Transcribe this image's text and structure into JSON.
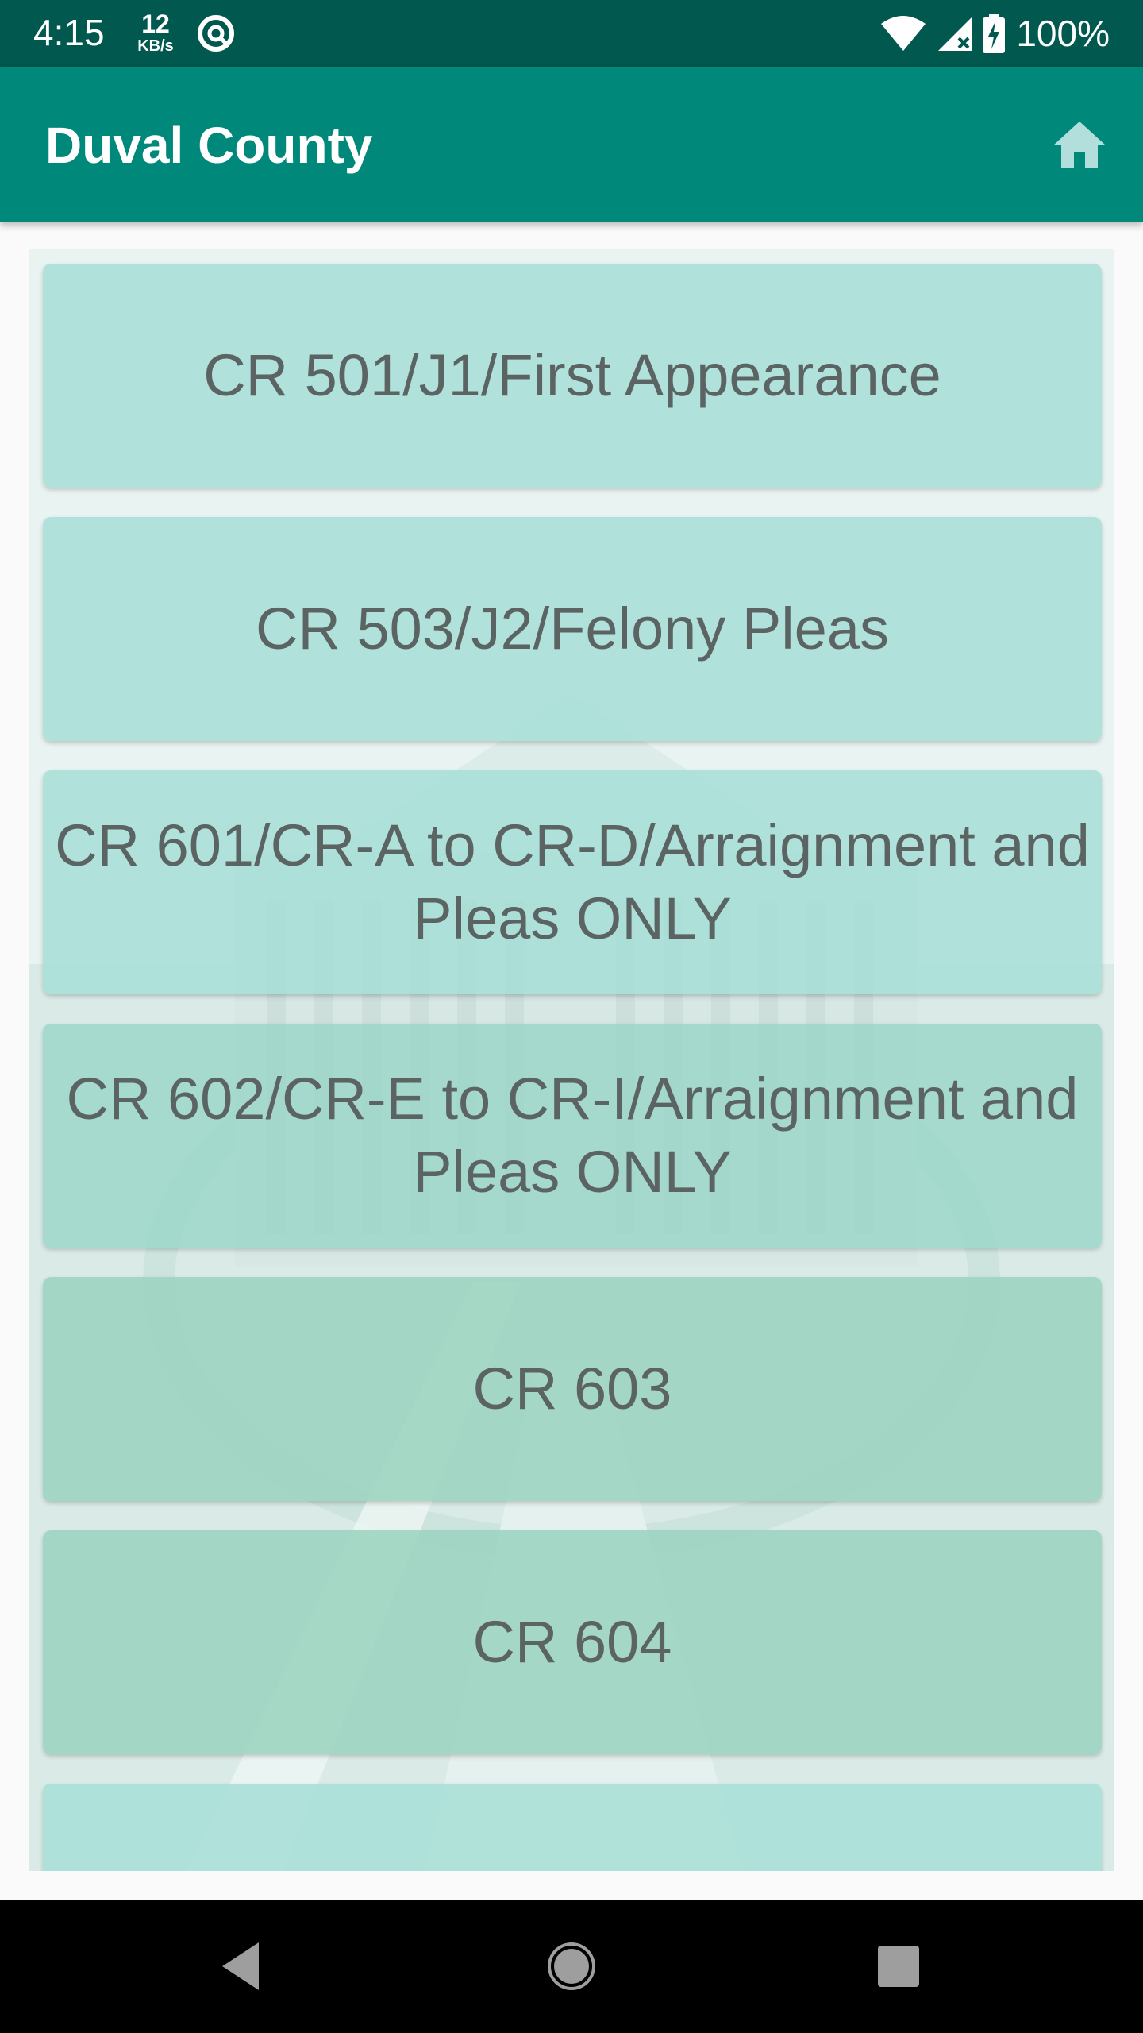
{
  "status_bar": {
    "time": "4:15",
    "network_speed_value": "12",
    "network_speed_unit": "KB/s",
    "battery_percent": "100%"
  },
  "app_bar": {
    "title": "Duval County",
    "home_icon": "home-icon"
  },
  "list": {
    "items": [
      {
        "label": "CR 501/J1/First Appearance"
      },
      {
        "label": "CR 503/J2/Felony Pleas"
      },
      {
        "label": "CR 601/CR-A to CR-D/Arraignment and Pleas ONLY"
      },
      {
        "label": "CR 602/CR-E to CR-I/Arraignment and Pleas ONLY"
      },
      {
        "label": "CR 603"
      },
      {
        "label": "CR 604"
      },
      {
        "label": ""
      }
    ]
  },
  "colors": {
    "status_bar": "#00584e",
    "app_bar": "#00897b",
    "button_bg": "#a4ded6",
    "button_text": "#5b6462"
  }
}
